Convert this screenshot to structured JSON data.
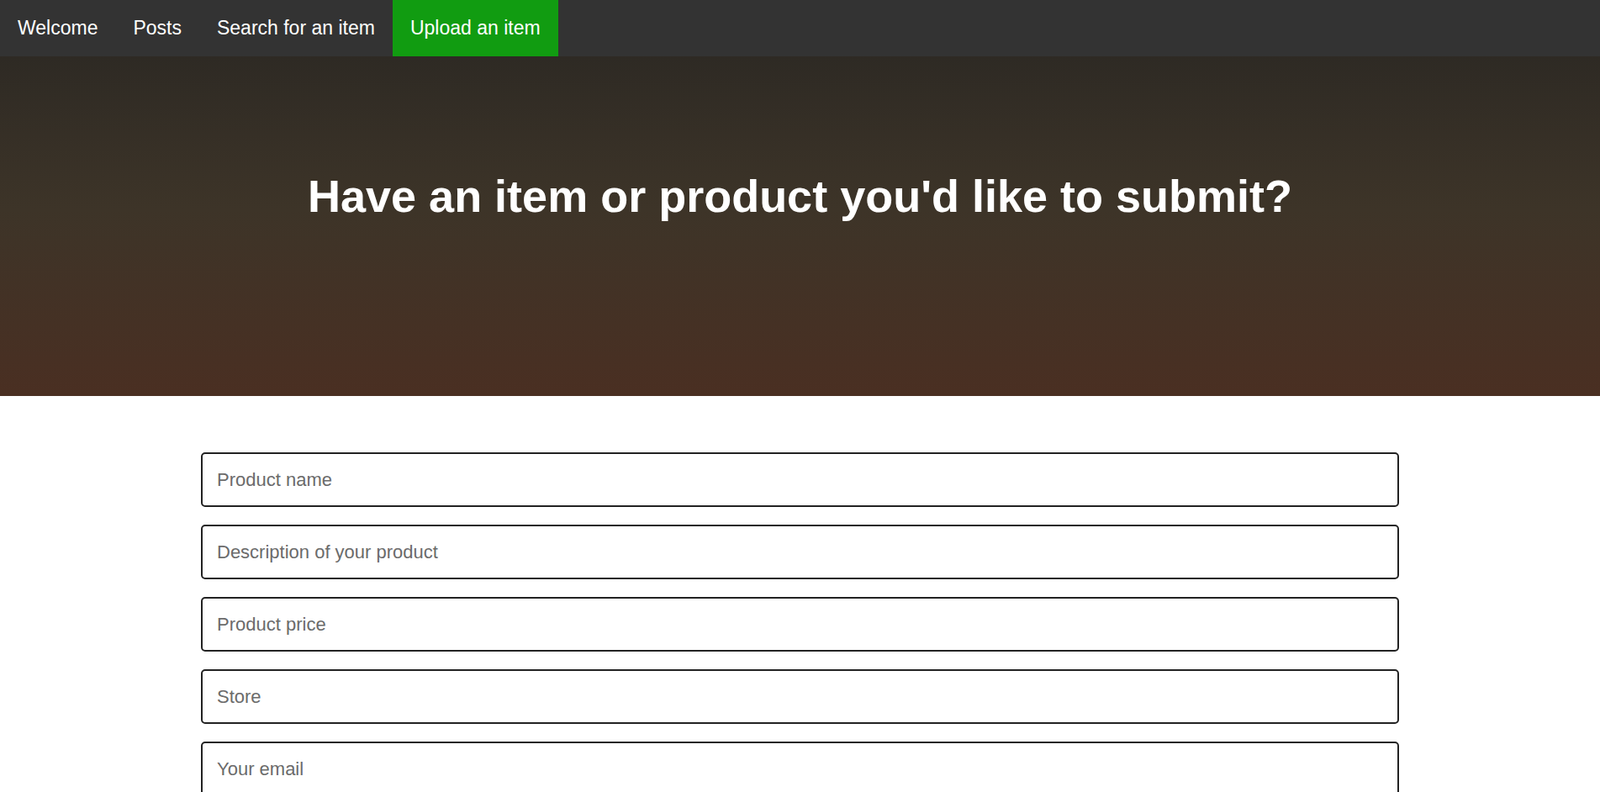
{
  "nav": {
    "items": [
      {
        "label": "Welcome",
        "selected": false
      },
      {
        "label": "Posts",
        "selected": false
      },
      {
        "label": "Search for an item",
        "selected": false
      },
      {
        "label": "Upload an item",
        "selected": true
      }
    ]
  },
  "hero": {
    "title": "Have an item or product you'd like to submit?"
  },
  "form": {
    "fields": [
      {
        "placeholder": "Product name"
      },
      {
        "placeholder": "Description of your product"
      },
      {
        "placeholder": "Product price"
      },
      {
        "placeholder": "Store"
      },
      {
        "placeholder": "Your email"
      }
    ]
  }
}
